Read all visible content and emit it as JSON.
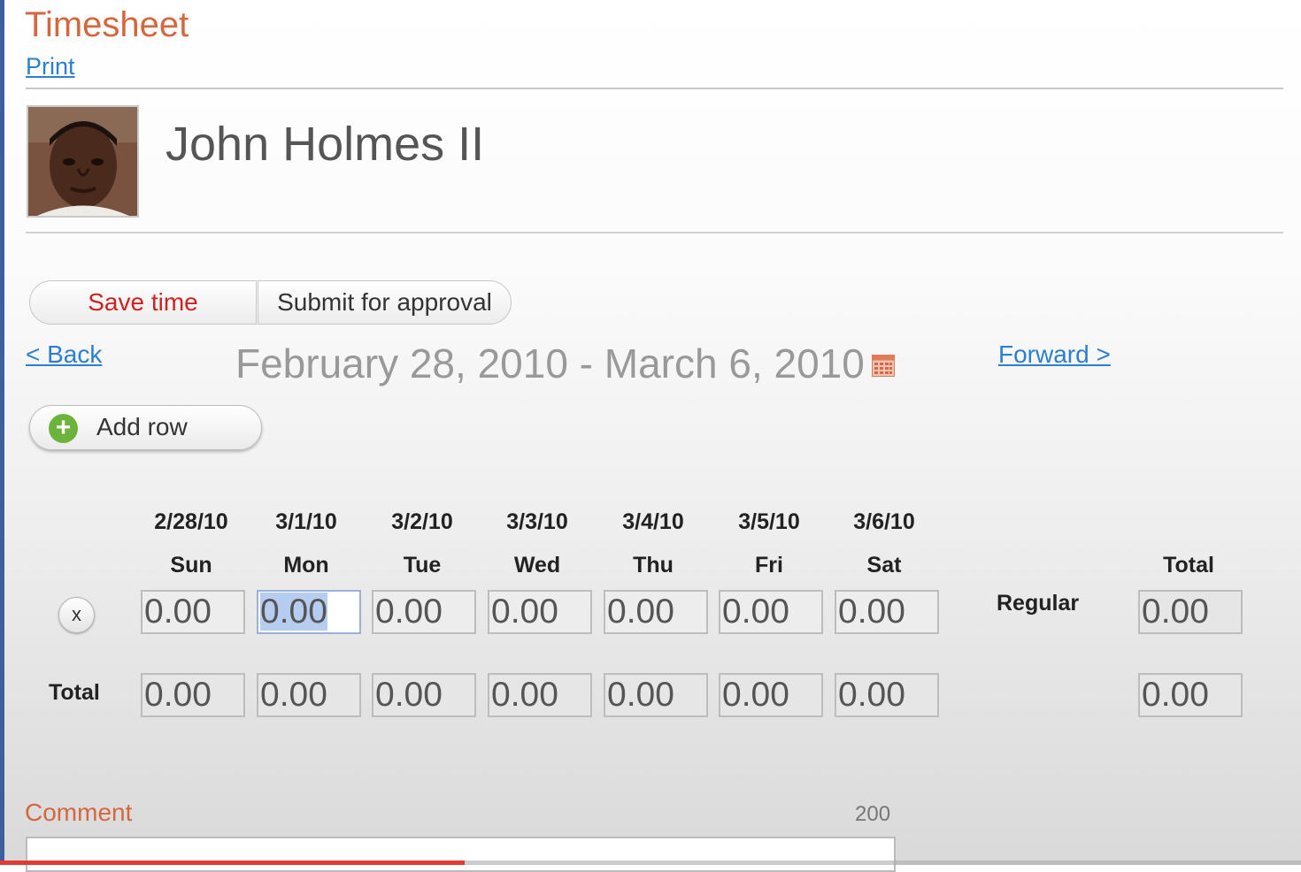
{
  "page": {
    "title": "Timesheet",
    "print_label": "Print"
  },
  "user": {
    "name": "John Holmes II"
  },
  "actions": {
    "save_label": "Save time",
    "submit_label": "Submit for approval",
    "add_row_label": "Add row",
    "add_row_icon": "plus-icon",
    "remove_row_label": "x"
  },
  "nav": {
    "back_label": "< Back",
    "forward_label": "Forward >",
    "date_range": "February 28, 2010 - March 6, 2010",
    "calendar_icon": "calendar-icon"
  },
  "grid": {
    "dates": [
      "2/28/10",
      "3/1/10",
      "3/2/10",
      "3/3/10",
      "3/4/10",
      "3/5/10",
      "3/6/10"
    ],
    "days": [
      "Sun",
      "Mon",
      "Tue",
      "Wed",
      "Thu",
      "Fri",
      "Sat"
    ],
    "total_header": "Total",
    "rows": [
      {
        "label": "Regular",
        "values": [
          "0.00",
          "0.00",
          "0.00",
          "0.00",
          "0.00",
          "0.00",
          "0.00"
        ],
        "total": "0.00"
      }
    ],
    "totals_row": {
      "label": "Total",
      "values": [
        "0.00",
        "0.00",
        "0.00",
        "0.00",
        "0.00",
        "0.00",
        "0.00"
      ],
      "total": "0.00"
    }
  },
  "comment": {
    "label": "Comment",
    "remaining": "200",
    "value": ""
  },
  "video_progress": 0.357,
  "colors": {
    "accent": "#d3683f",
    "link": "#2c7fcf",
    "save": "#cc2222",
    "add": "#6bb33a",
    "progress": "#e53935"
  }
}
